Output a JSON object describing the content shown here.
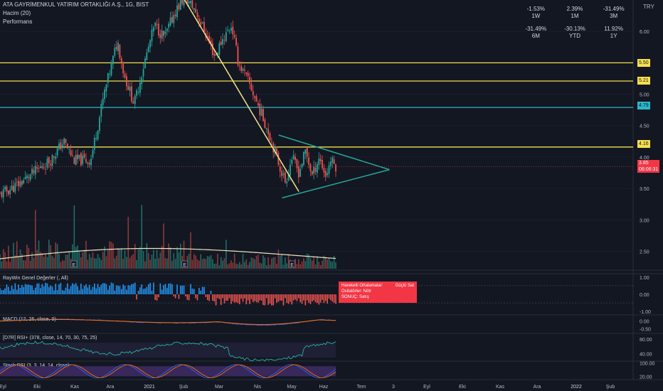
{
  "header": {
    "title": "ATA GAYRİMENKUL YATIRIM ORTAKLIĞI A.Ş., 1G, BIST",
    "volume": "Hacim (20)",
    "performance": "Performans"
  },
  "currency": "TRY",
  "performance": [
    {
      "value": "-1.53%",
      "label": "1W",
      "tone": "neg"
    },
    {
      "value": "2.39%",
      "label": "1M",
      "tone": "pos"
    },
    {
      "value": "-31.49%",
      "label": "3M",
      "tone": "neg"
    },
    {
      "value": "-31.49%",
      "label": "6M",
      "tone": "neg"
    },
    {
      "value": "-30.13%",
      "label": "YTD",
      "tone": "neg"
    },
    {
      "value": "11.92%",
      "label": "1Y",
      "tone": "pos"
    }
  ],
  "tooltip": {
    "ma_label": "Hareketli Ortalamalar:",
    "ma_value": "Güçlü Sat",
    "osc_label": "Osilatörler: Nötr",
    "result_label": "SONUÇ:",
    "result_value": "Satış"
  },
  "price_tags": {
    "last_price": "3.85",
    "countdown": "06:06:31",
    "h1": "5.50",
    "h2": "5.21",
    "h3": "4.79",
    "h4": "4.16"
  },
  "colors": {
    "background": "#131722",
    "up": "#26a69a",
    "down": "#ef5350",
    "hline_yellow": "#f5e04f",
    "hline_teal": "#2ab7c9",
    "trendline": "#f5e58a",
    "triangle": "#26a69a",
    "volume_ma": "#f0e6c0",
    "stoch_band": "#3d2a63"
  },
  "chart_data": [
    {
      "type": "candlestick",
      "title": "ATA GAYRİMENKUL YATIRIM ORTAKLIĞI A.Ş., 1G, BIST",
      "x_ticks": [
        "Eyl",
        "Eki",
        "Kas",
        "Ara",
        "2021",
        "Şub",
        "Mar",
        "Nis",
        "May",
        "Haz",
        "Tem",
        "3",
        "Eyl",
        "Eki",
        "Kas",
        "Ara",
        "2022",
        "Şub"
      ],
      "y_ticks": [
        6.0,
        5.5,
        5.0,
        4.5,
        4.0,
        3.5,
        3.0,
        2.5
      ],
      "ylim": [
        2.2,
        6.5
      ],
      "close_path": [
        {
          "t": 0,
          "v": 3.4
        },
        {
          "t": 0.05,
          "v": 3.55
        },
        {
          "t": 0.1,
          "v": 3.75
        },
        {
          "t": 0.15,
          "v": 3.95
        },
        {
          "t": 0.19,
          "v": 4.25
        },
        {
          "t": 0.22,
          "v": 3.95
        },
        {
          "t": 0.27,
          "v": 3.95
        },
        {
          "t": 0.31,
          "v": 5.0
        },
        {
          "t": 0.35,
          "v": 5.85
        },
        {
          "t": 0.37,
          "v": 5.3
        },
        {
          "t": 0.4,
          "v": 4.85
        },
        {
          "t": 0.43,
          "v": 5.5
        },
        {
          "t": 0.46,
          "v": 6.1
        },
        {
          "t": 0.49,
          "v": 5.9
        },
        {
          "t": 0.52,
          "v": 6.3
        },
        {
          "t": 0.55,
          "v": 6.55
        },
        {
          "t": 0.58,
          "v": 6.35
        },
        {
          "t": 0.61,
          "v": 6.0
        },
        {
          "t": 0.64,
          "v": 5.6
        },
        {
          "t": 0.66,
          "v": 5.85
        },
        {
          "t": 0.69,
          "v": 6.1
        },
        {
          "t": 0.71,
          "v": 5.5
        },
        {
          "t": 0.74,
          "v": 5.2
        },
        {
          "t": 0.77,
          "v": 4.8
        },
        {
          "t": 0.8,
          "v": 4.4
        },
        {
          "t": 0.83,
          "v": 3.9
        },
        {
          "t": 0.85,
          "v": 3.6
        },
        {
          "t": 0.87,
          "v": 4.0
        },
        {
          "t": 0.89,
          "v": 3.75
        },
        {
          "t": 0.91,
          "v": 4.1
        },
        {
          "t": 0.93,
          "v": 3.7
        },
        {
          "t": 0.95,
          "v": 4.0
        },
        {
          "t": 0.97,
          "v": 3.7
        },
        {
          "t": 0.985,
          "v": 3.95
        },
        {
          "t": 1,
          "v": 3.85
        }
      ],
      "horizontal_lines": [
        5.5,
        5.21,
        4.79,
        4.16
      ],
      "last_price": 3.85,
      "trendline": [
        {
          "t": 0.55,
          "v": 6.5
        },
        {
          "t": 0.89,
          "v": 3.45
        }
      ],
      "triangle": {
        "apex": {
          "t": 1.16,
          "v": 3.8
        },
        "upper_start": {
          "t": 0.83,
          "v": 4.35
        },
        "lower_start": {
          "t": 0.84,
          "v": 3.35
        }
      }
    },
    {
      "type": "bar",
      "title": "Hacim (20)",
      "y_ticks": [],
      "event_markers": [
        "E",
        "E",
        "E"
      ],
      "marker_positions_t": [
        0.22,
        0.55,
        0.87
      ]
    },
    {
      "type": "bar",
      "title": "RayWin Genel Değerler (, All)",
      "y_ticks": [
        1.0,
        0.0,
        -1.0
      ],
      "ylim": [
        -1.2,
        1.2
      ]
    },
    {
      "type": "line",
      "title": "MACD (12, 26, close, 9)",
      "y_ticks": [
        0.0,
        -0.5
      ],
      "ylim": [
        -0.8,
        0.4
      ]
    },
    {
      "type": "line",
      "title": "[D7R] RSI+ (378, close, 14, 70, 30, 75, 25)",
      "y_ticks": [
        80.0,
        40.0
      ],
      "ylim": [
        20,
        95
      ]
    },
    {
      "type": "line",
      "title": "Stoch RSI (3, 3, 14, 14, close)",
      "y_ticks": [
        100.0,
        20.0
      ],
      "ylim": [
        0,
        110
      ]
    }
  ]
}
